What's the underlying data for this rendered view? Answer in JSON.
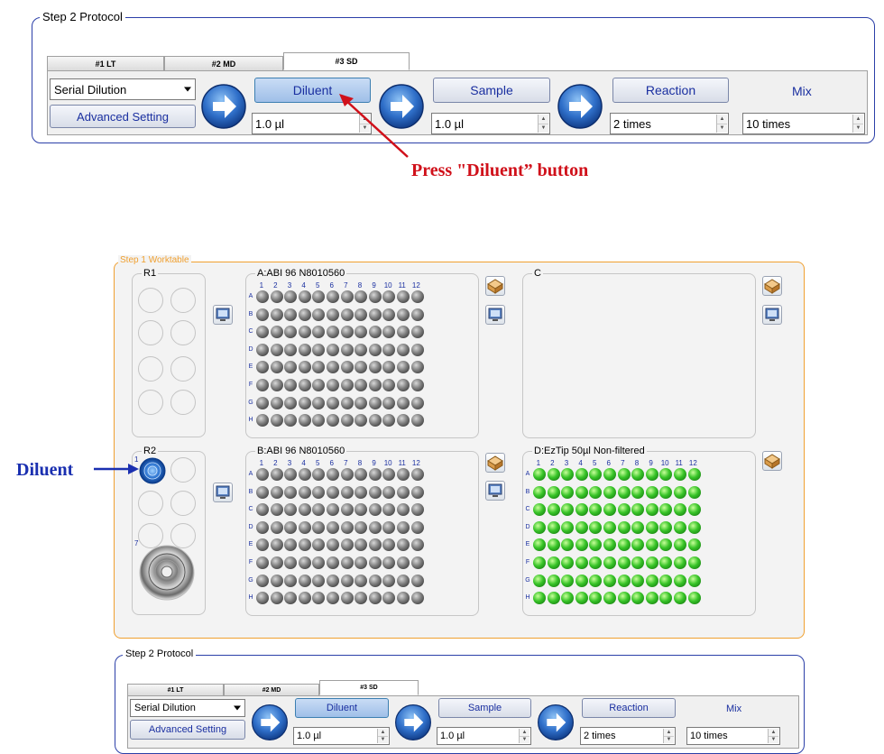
{
  "protocol_top": {
    "legend": "Step 2 Protocol",
    "tabs": [
      "#1 LT",
      "#2 MD",
      "#3 SD"
    ],
    "mode": "Serial Dilution",
    "advanced": "Advanced Setting",
    "diluent": "Diluent",
    "sample": "Sample",
    "reaction": "Reaction",
    "mix": "Mix",
    "diluent_value": "1.0 µl",
    "sample_value": "1.0 µl",
    "reaction_value": "2 times",
    "mix_value": "10 times"
  },
  "annotation_press": "Press \"Diluent” button",
  "annotation_diluent": "Diluent",
  "worktable": {
    "legend": "Step 1 Worktable",
    "r1": "R1",
    "r2": "R2",
    "r2_num1": "1",
    "r2_num7": "7",
    "plate_a": "A:ABI 96 N8010560",
    "plate_b": "B:ABI 96 N8010560",
    "plate_c": "C",
    "plate_d": "D:EzTip 50µl Non-filtered",
    "columns": [
      "1",
      "2",
      "3",
      "4",
      "5",
      "6",
      "7",
      "8",
      "9",
      "10",
      "11",
      "12"
    ],
    "rows": [
      "A",
      "B",
      "C",
      "D",
      "E",
      "F",
      "G",
      "H"
    ]
  },
  "protocol_bottom": {
    "legend": "Step 2 Protocol",
    "tabs": [
      "#1 LT",
      "#2 MD",
      "#3 SD"
    ],
    "mode": "Serial Dilution",
    "advanced": "Advanced Setting",
    "diluent": "Diluent",
    "sample": "Sample",
    "reaction": "Reaction",
    "mix": "Mix",
    "diluent_value": "1.0 µl",
    "sample_value": "1.0 µl",
    "reaction_value": "2 times",
    "mix_value": "10 times"
  },
  "colors": {
    "accent_blue": "#1a2fa0",
    "annotation_red": "#d0101a",
    "worktable_border": "#f0a030",
    "tip_green": "#38c428"
  }
}
